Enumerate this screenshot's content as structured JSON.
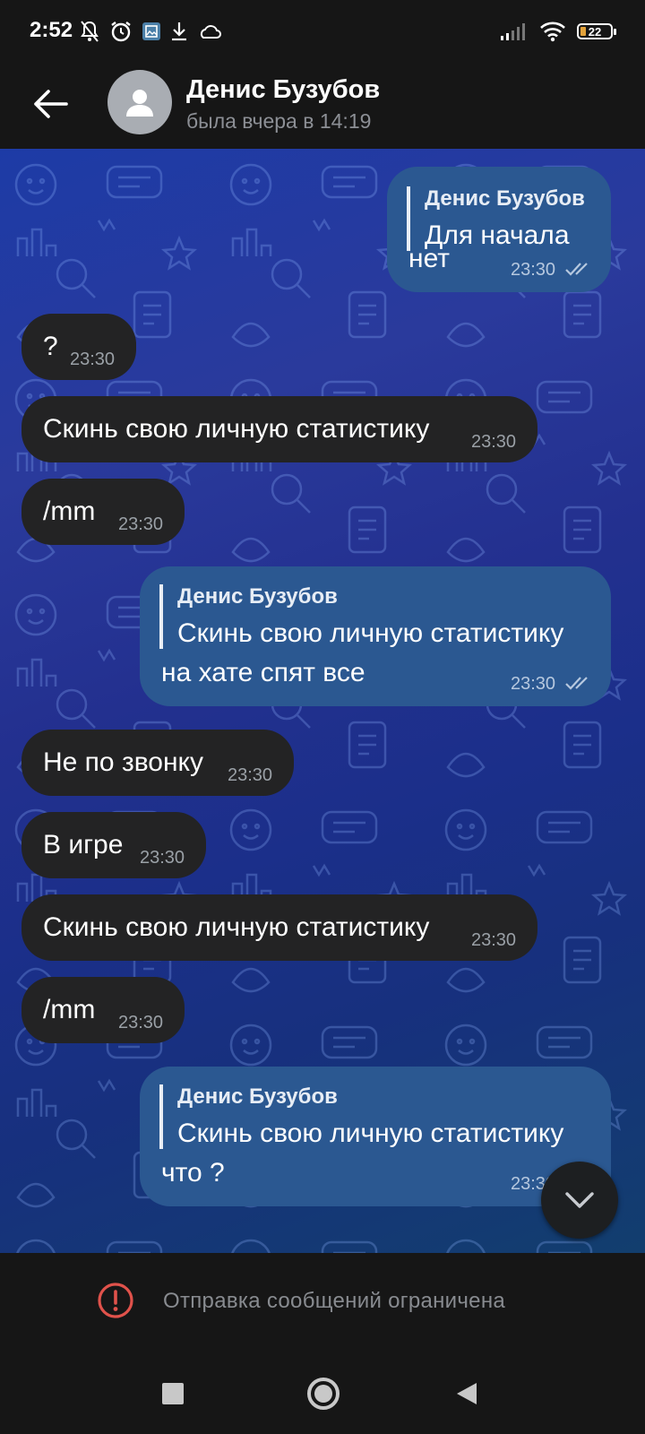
{
  "status_bar": {
    "time": "2:52",
    "battery_level": "22",
    "icons": [
      "bell-off-icon",
      "alarm-icon",
      "gallery-icon",
      "download-icon",
      "cloud-icon",
      "signal-icon",
      "wifi-icon",
      "battery-icon"
    ]
  },
  "header": {
    "name": "Денис Бузубов",
    "status": "была вчера в 14:19"
  },
  "messages": [
    {
      "direction": "out",
      "reply_name": "Денис Бузубов",
      "reply_text": "Для начала",
      "text": "нет",
      "time": "23:30",
      "read": true
    },
    {
      "direction": "in",
      "text": "?",
      "time": "23:30"
    },
    {
      "direction": "in",
      "text": "Скинь свою личную статистику",
      "time": "23:30"
    },
    {
      "direction": "in",
      "text": "/mm",
      "time": "23:30"
    },
    {
      "direction": "out",
      "reply_name": "Денис Бузубов",
      "reply_text": "Скинь свою личную статистику",
      "text": "на хате спят все",
      "time": "23:30",
      "read": true
    },
    {
      "direction": "in",
      "text": "Не по звонку",
      "time": "23:30"
    },
    {
      "direction": "in",
      "text": "В игре",
      "time": "23:30"
    },
    {
      "direction": "in",
      "text": "Скинь свою личную статистику",
      "time": "23:30"
    },
    {
      "direction": "in",
      "text": "/mm",
      "time": "23:30"
    },
    {
      "direction": "out",
      "reply_name": "Денис Бузубов",
      "reply_text": "Скинь свою личную статистику",
      "text": "что ?",
      "time": "23:30",
      "read": true
    }
  ],
  "restriction": {
    "text": "Отправка сообщений ограничена"
  },
  "colors": {
    "incoming_bubble": "#232324",
    "outgoing_bubble": "#2b5891",
    "warning": "#e0524b"
  }
}
